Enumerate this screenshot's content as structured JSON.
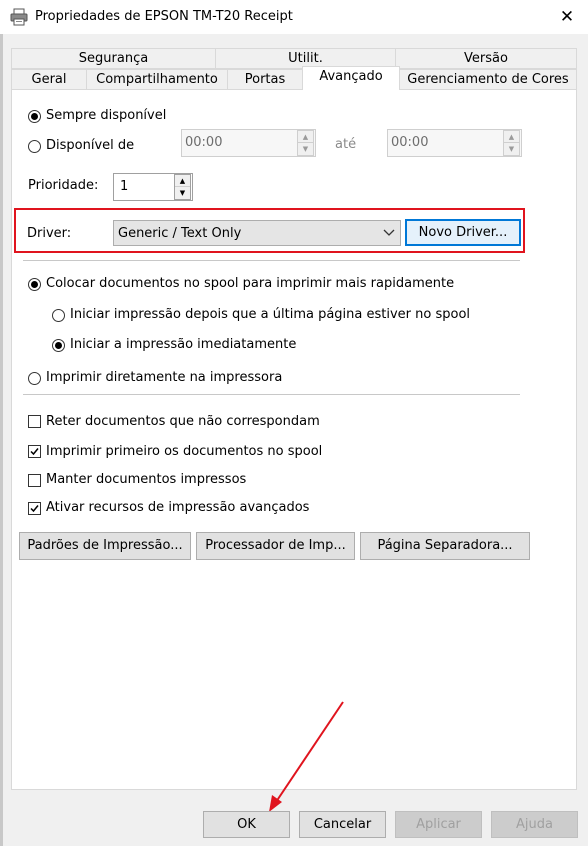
{
  "window": {
    "title": "Propriedades de EPSON TM-T20 Receipt",
    "close_glyph": "✕"
  },
  "tabs": {
    "row1": [
      "Segurança",
      "Utilit.",
      "Versão"
    ],
    "row2": [
      "Geral",
      "Compartilhamento",
      "Portas",
      "Avançado",
      "Gerenciamento de Cores"
    ],
    "active": "Avançado"
  },
  "availability": {
    "always_label": "Sempre disponível",
    "always_selected": true,
    "from_label": "Disponível de",
    "from_time": "00:00",
    "until_label": "até",
    "until_time": "00:00"
  },
  "priority": {
    "label": "Prioridade:",
    "value": "1"
  },
  "driver": {
    "label": "Driver:",
    "selected": "Generic / Text Only",
    "new_driver_button": "Novo Driver...",
    "highlight_color": "#e0141e"
  },
  "spool": {
    "spool_label": "Colocar documentos no spool para imprimir mais rapidamente",
    "spool_selected": true,
    "start_after_last_page": "Iniciar impressão depois que a última página estiver no spool",
    "start_immediately": "Iniciar a impressão imediatamente",
    "start_immediately_selected": true,
    "print_direct": "Imprimir diretamente na impressora"
  },
  "options": [
    {
      "label": "Reter documentos que não correspondam",
      "checked": false
    },
    {
      "label": "Imprimir primeiro os documentos no spool",
      "checked": true
    },
    {
      "label": "Manter documentos impressos",
      "checked": false
    },
    {
      "label": "Ativar recursos de impressão avançados",
      "checked": true
    }
  ],
  "bottom_buttons": {
    "defaults": "Padrões de Impressão...",
    "processor": "Processador de Imp...",
    "separator_page": "Página Separadora..."
  },
  "dialog_buttons": {
    "ok": "OK",
    "cancel": "Cancelar",
    "apply": "Aplicar",
    "help": "Ajuda"
  },
  "colors": {
    "accent": "#0078d7",
    "annotation_red": "#e0141e"
  }
}
